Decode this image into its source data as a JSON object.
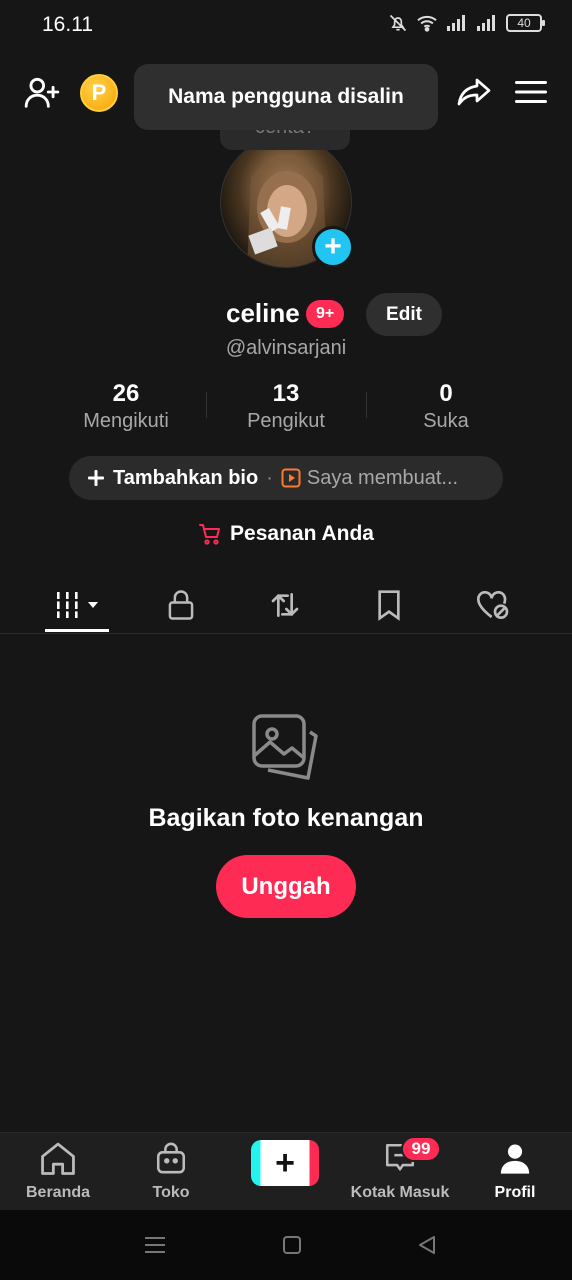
{
  "status_bar": {
    "time": "16.11",
    "battery": "40",
    "icons": [
      "mute-icon",
      "wifi-icon",
      "signal-icon",
      "signal-icon",
      "battery-icon"
    ]
  },
  "header": {
    "toast": "Nama pengguna disalin",
    "story_bubble": "cerita?",
    "coin_label": "P"
  },
  "profile": {
    "name": "celine",
    "badge": "9+",
    "edit_label": "Edit",
    "handle": "@alvinsarjani",
    "stats": [
      {
        "value": "26",
        "label": "Mengikuti"
      },
      {
        "value": "13",
        "label": "Pengikut"
      },
      {
        "value": "0",
        "label": "Suka"
      }
    ],
    "bio_add_label": "Tambahkan bio",
    "bio_separator": "·",
    "bio_extra_label": "Saya membuat...",
    "orders_label": "Pesanan Anda"
  },
  "tabs": [
    "grid-icon",
    "lock-icon",
    "repost-icon",
    "bookmark-icon",
    "liked-icon"
  ],
  "empty_state": {
    "title": "Bagikan foto kenangan",
    "button": "Unggah"
  },
  "bottom_nav": {
    "items": [
      {
        "label": "Beranda",
        "icon": "home-icon"
      },
      {
        "label": "Toko",
        "icon": "shop-icon"
      },
      {
        "label": "Kotak Masuk",
        "icon": "inbox-icon"
      },
      {
        "label": "Profil",
        "icon": "profile-icon"
      }
    ],
    "inbox_badge": "99",
    "create_label": "+"
  },
  "colors": {
    "accent": "#fe2c55",
    "cyan": "#20c5f1",
    "background": "#161616"
  }
}
